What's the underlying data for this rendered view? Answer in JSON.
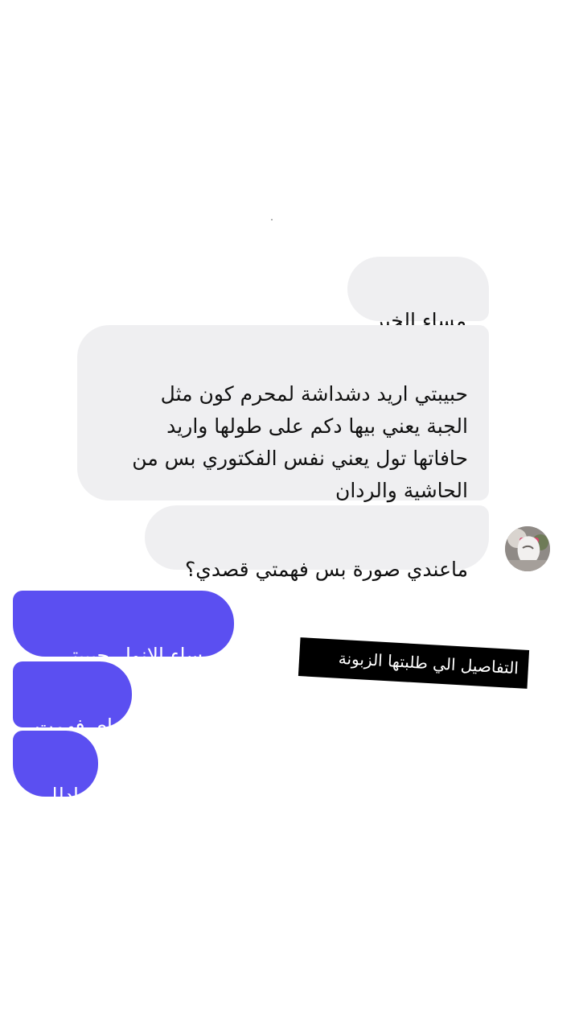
{
  "messages": {
    "incoming": [
      {
        "text": "مساء الخير"
      },
      {
        "text": "حبيبتي اريد دشداشة لمحرم كون مثل\nالجبة يعني بيها دكم على طولها واريد\nحافاتها تول يعني نفس الفكتوري بس من\nالحاشية والردان"
      },
      {
        "text": "ماعندي صورة بس فهمتي قصدي؟"
      }
    ],
    "outgoing": [
      {
        "text": "مساء الانوار حبيبتي"
      },
      {
        "text": "اي فهمت"
      },
      {
        "text": "ادللي"
      }
    ]
  },
  "annotation": {
    "text": "التفاصيل الي طلبتها الزبونة"
  },
  "colors": {
    "incoming_bubble": "#efeff1",
    "outgoing_bubble": "#5b4ff1",
    "annotation_background": "#000000"
  },
  "icons": {
    "avatar": "contact-avatar-image"
  }
}
